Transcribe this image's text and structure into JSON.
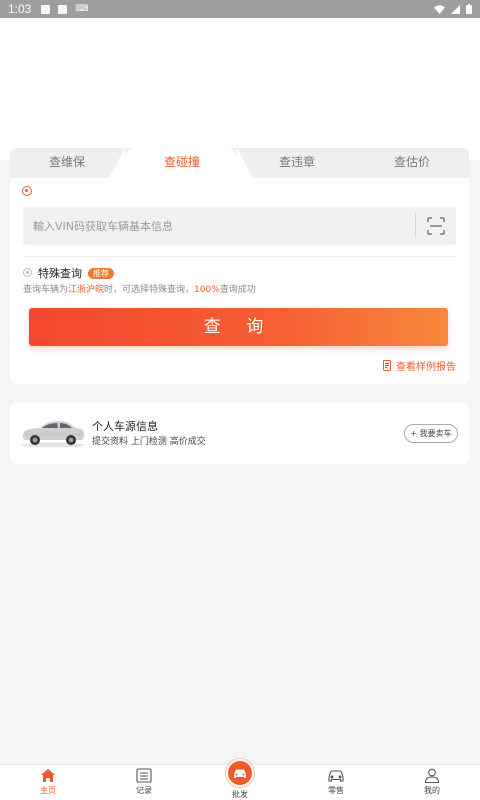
{
  "status_bar": {
    "time": "1:03"
  },
  "tabs": [
    {
      "label": "查维保",
      "active": false
    },
    {
      "label": "查碰撞",
      "active": true
    },
    {
      "label": "查违章",
      "active": false
    },
    {
      "label": "查估价",
      "active": false
    }
  ],
  "vin": {
    "placeholder": "輸入VIN码获取车辆基本信息"
  },
  "special": {
    "title": "特殊查询",
    "badge": "推荐",
    "desc_prefix": "查询车辆为",
    "desc_region": "江浙沪皖",
    "desc_mid": "时，可选择特殊查询，",
    "desc_rate": "100%",
    "desc_suffix": "查询成功"
  },
  "query_button": "查 询",
  "sample_link": "查看样例报告",
  "car_card": {
    "title": "个人车源信息",
    "subtitle": "提交资料 上门检测 高价成交",
    "sell_button": "+ 我要卖车"
  },
  "bottom_nav": [
    {
      "label": "主页",
      "icon": "home-icon",
      "active": true
    },
    {
      "label": "记录",
      "icon": "list-icon",
      "active": false
    },
    {
      "label": "批发",
      "icon": "car-circle-icon",
      "active": false
    },
    {
      "label": "零售",
      "icon": "car-outline-icon",
      "active": false
    },
    {
      "label": "我的",
      "icon": "person-icon",
      "active": false
    }
  ],
  "colors": {
    "accent": "#f15a2b",
    "badge": "#f47a2a",
    "background": "#f5f5f5"
  }
}
